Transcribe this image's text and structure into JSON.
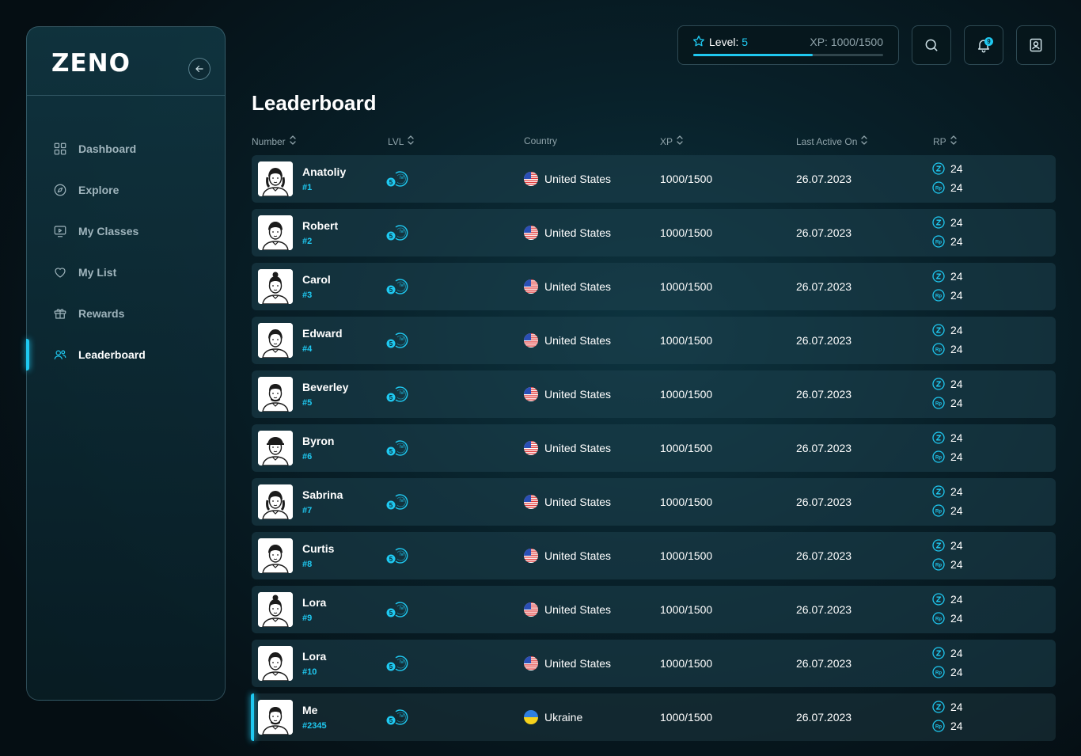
{
  "app": {
    "logo": "ZENO"
  },
  "sidebar": {
    "items": [
      {
        "label": "Dashboard",
        "icon": "grid-icon",
        "active": false
      },
      {
        "label": "Explore",
        "icon": "compass-icon",
        "active": false
      },
      {
        "label": "My Classes",
        "icon": "video-icon",
        "active": false
      },
      {
        "label": "My List",
        "icon": "heart-icon",
        "active": false
      },
      {
        "label": "Rewards",
        "icon": "gift-icon",
        "active": false
      },
      {
        "label": "Leaderboard",
        "icon": "users-icon",
        "active": true
      }
    ]
  },
  "header": {
    "level_label": "Level:",
    "level_value": "5",
    "xp_label": "XP: 1000/1500",
    "xp_progress": 0.63,
    "notification_count": "9"
  },
  "page": {
    "title": "Leaderboard"
  },
  "table": {
    "columns": [
      "Number",
      "LVL",
      "Country",
      "XP",
      "Last Active On",
      "RP"
    ],
    "rows": [
      {
        "name": "Anatoliy",
        "rank": "#1",
        "level": "5",
        "country": "United States",
        "xp": "1000/1500",
        "last_active": "26.07.2023",
        "z_points": "24",
        "rp_points": "24"
      },
      {
        "name": "Robert",
        "rank": "#2",
        "level": "5",
        "country": "United States",
        "xp": "1000/1500",
        "last_active": "26.07.2023",
        "z_points": "24",
        "rp_points": "24"
      },
      {
        "name": "Carol",
        "rank": "#3",
        "level": "5",
        "country": "United States",
        "xp": "1000/1500",
        "last_active": "26.07.2023",
        "z_points": "24",
        "rp_points": "24"
      },
      {
        "name": "Edward",
        "rank": "#4",
        "level": "5",
        "country": "United States",
        "xp": "1000/1500",
        "last_active": "26.07.2023",
        "z_points": "24",
        "rp_points": "24"
      },
      {
        "name": "Beverley",
        "rank": "#5",
        "level": "5",
        "country": "United States",
        "xp": "1000/1500",
        "last_active": "26.07.2023",
        "z_points": "24",
        "rp_points": "24"
      },
      {
        "name": "Byron",
        "rank": "#6",
        "level": "5",
        "country": "United States",
        "xp": "1000/1500",
        "last_active": "26.07.2023",
        "z_points": "24",
        "rp_points": "24"
      },
      {
        "name": "Sabrina",
        "rank": "#7",
        "level": "5",
        "country": "United States",
        "xp": "1000/1500",
        "last_active": "26.07.2023",
        "z_points": "24",
        "rp_points": "24"
      },
      {
        "name": "Curtis",
        "rank": "#8",
        "level": "5",
        "country": "United States",
        "xp": "1000/1500",
        "last_active": "26.07.2023",
        "z_points": "24",
        "rp_points": "24"
      },
      {
        "name": "Lora",
        "rank": "#9",
        "level": "5",
        "country": "United States",
        "xp": "1000/1500",
        "last_active": "26.07.2023",
        "z_points": "24",
        "rp_points": "24"
      },
      {
        "name": "Lora",
        "rank": "#10",
        "level": "5",
        "country": "United States",
        "xp": "1000/1500",
        "last_active": "26.07.2023",
        "z_points": "24",
        "rp_points": "24"
      },
      {
        "name": "Me",
        "rank": "#2345",
        "level": "5",
        "country": "Ukraine",
        "xp": "1000/1500",
        "last_active": "26.07.2023",
        "z_points": "24",
        "rp_points": "24",
        "is_me": true
      }
    ]
  },
  "icons": {
    "lvl_text": "lvl",
    "rp_coin_text": "Rp"
  },
  "colors": {
    "accent": "#1fc8f0",
    "row_bg": "#1e424e"
  }
}
